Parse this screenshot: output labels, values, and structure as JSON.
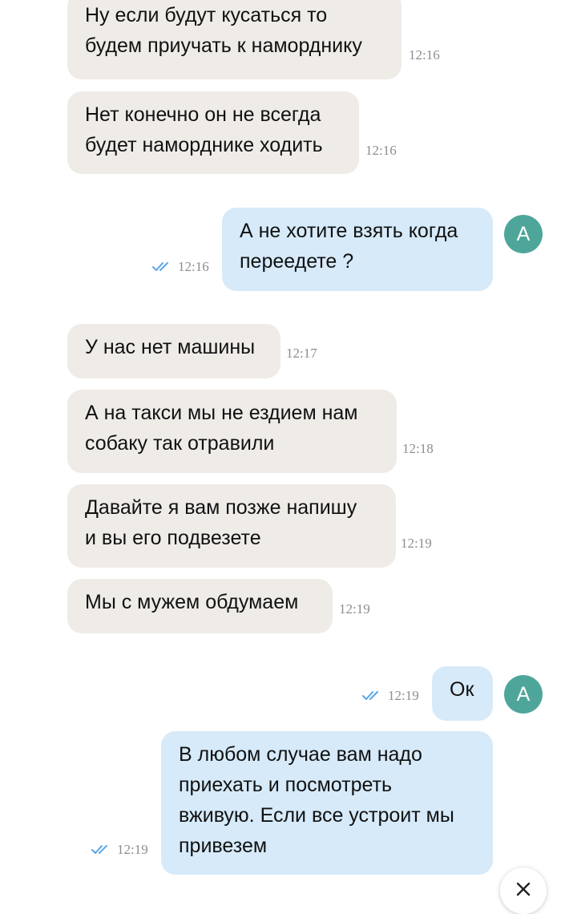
{
  "messages": [
    {
      "id": 1,
      "direction": "in",
      "text": "Ну если будут кусаться то\nбудем приучать к наморднику",
      "time": "12:16"
    },
    {
      "id": 2,
      "direction": "in",
      "text": "Нет конечно он не всегда\nбудет наморднике ходить",
      "time": "12:16"
    },
    {
      "id": 3,
      "direction": "out",
      "text": "А не хотите взять когда\nпереедете ?",
      "time": "12:16",
      "status": "read",
      "avatar": "A"
    },
    {
      "id": 4,
      "direction": "in",
      "text": "У нас нет машины",
      "time": "12:17"
    },
    {
      "id": 5,
      "direction": "in",
      "text": "А на такси мы не ездием нам\nсобаку так отравили",
      "time": "12:18"
    },
    {
      "id": 6,
      "direction": "in",
      "text": "Давайте я вам позже напишу\nи вы его подвезете",
      "time": "12:19"
    },
    {
      "id": 7,
      "direction": "in",
      "text": "Мы с мужем обдумаем",
      "time": "12:19"
    },
    {
      "id": 8,
      "direction": "out",
      "text": "Ок",
      "time": "12:19",
      "status": "read",
      "avatar": "A"
    },
    {
      "id": 9,
      "direction": "out",
      "text": "В любом случае вам надо\nприехать и посмотреть\nвживую. Если все устроит мы\nпривезем",
      "time": "12:19",
      "status": "read"
    }
  ],
  "colors": {
    "incoming_bubble": "#efece8",
    "outgoing_bubble": "#d6eaf9",
    "avatar": "#4ea69a",
    "read_check": "#5aa7e6",
    "timestamp": "#8e8e93"
  },
  "icons": {
    "read_status": "double-check-icon",
    "close": "close-icon"
  }
}
